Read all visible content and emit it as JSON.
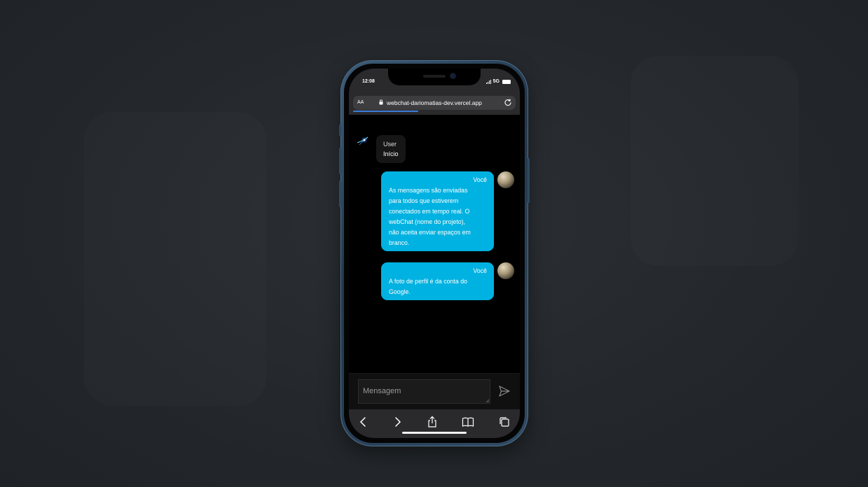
{
  "status_bar": {
    "time": "12:08",
    "network": "5G"
  },
  "browser": {
    "text_size_label": "AA",
    "url": "webchat-dariomatias-dev.vercel.app",
    "load_progress": 0.4
  },
  "messages": [
    {
      "sender": "User",
      "text": "Início",
      "side": "left"
    },
    {
      "sender": "Você",
      "lines": [
        "As mensagens são enviadas",
        "para todos que estiverem",
        "conectados em tempo real. O",
        "webChat (nome do projeto),",
        "não aceita enviar espaços em",
        "branco."
      ],
      "side": "right"
    },
    {
      "sender": "Você",
      "lines": [
        "A foto de perfil é da conta do",
        "Google."
      ],
      "side": "right"
    }
  ],
  "composer": {
    "placeholder": "Mensagem"
  },
  "icons": {
    "lock": "lock-icon",
    "reload": "reload-icon",
    "send": "send-icon",
    "back": "chevron-left-icon",
    "forward": "chevron-right-icon",
    "share": "share-icon",
    "bookmarks": "book-icon",
    "tabs": "tabs-icon"
  },
  "colors": {
    "outgoing_bubble": "#00b2e1",
    "incoming_bubble": "#161616",
    "chat_background": "#000000",
    "page_background": "#25292d"
  }
}
